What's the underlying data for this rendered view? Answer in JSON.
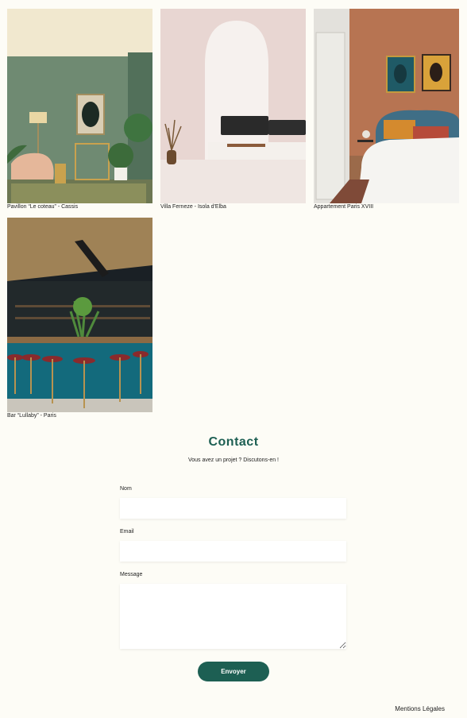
{
  "gallery": {
    "items": [
      {
        "caption": "Pavillon “Le coteau” - Cassis",
        "image": "green-living-room-photo"
      },
      {
        "caption": "Villa Ferneze - Isola d'Elba",
        "image": "white-arch-lounge-photo"
      },
      {
        "caption": "Appartement Paris XVIII",
        "image": "terracotta-bedroom-photo"
      },
      {
        "caption": "Bar “Lullaby” - Paris",
        "image": "teal-bar-photo"
      }
    ]
  },
  "contact": {
    "title": "Contact",
    "subtitle": "Vous avez un projet ? Discutons-en !",
    "name_label": "Nom",
    "email_label": "Email",
    "message_label": "Message",
    "name_value": "",
    "email_value": "",
    "message_value": "",
    "submit_label": "Envoyer"
  },
  "footer": {
    "legal_link": "Mentions Légales"
  },
  "colors": {
    "accent": "#1d5f53",
    "background": "#fdfcf6"
  }
}
